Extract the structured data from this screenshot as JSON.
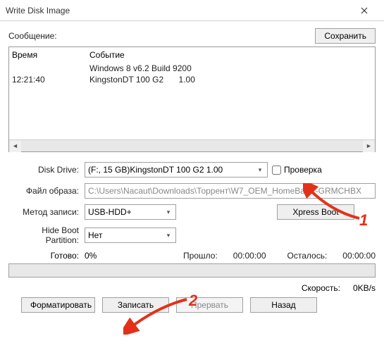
{
  "window": {
    "title": "Write Disk Image"
  },
  "messages": {
    "label": "Сообщение:",
    "save_button": "Сохранить"
  },
  "log": {
    "col_time": "Время",
    "col_event": "Событие",
    "rows": [
      {
        "time": "",
        "event": "Windows 8 v6.2 Build 9200"
      },
      {
        "time": "12:21:40",
        "event_name": "KingstonDT 100 G2",
        "event_ver": "1.00"
      }
    ]
  },
  "form": {
    "disk_drive_label": "Disk Drive:",
    "disk_drive_value": "(F:, 15 GB)KingstonDT 100 G2      1.00",
    "check_label": "Проверка",
    "image_label": "Файл образа:",
    "image_value": "C:\\Users\\Nacaut\\Downloads\\Торрент\\W7_OEM_HomeBasic-GRMCHBX",
    "method_label": "Метод записи:",
    "method_value": "USB-HDD+",
    "xpress_button": "Xpress Boot",
    "hide_label": "Hide Boot Partition:",
    "hide_value": "Нет"
  },
  "status": {
    "ready_label": "Готово:",
    "ready_value": "0%",
    "elapsed_label": "Прошло:",
    "elapsed_value": "00:00:00",
    "remain_label": "Осталось:",
    "remain_value": "00:00:00",
    "speed_label": "Скорость:",
    "speed_value": "0KB/s"
  },
  "buttons": {
    "format": "Форматировать",
    "write": "Записать",
    "abort": "Прервать",
    "back": "Назад"
  },
  "annotations": {
    "a1": "1",
    "a2": "2"
  }
}
